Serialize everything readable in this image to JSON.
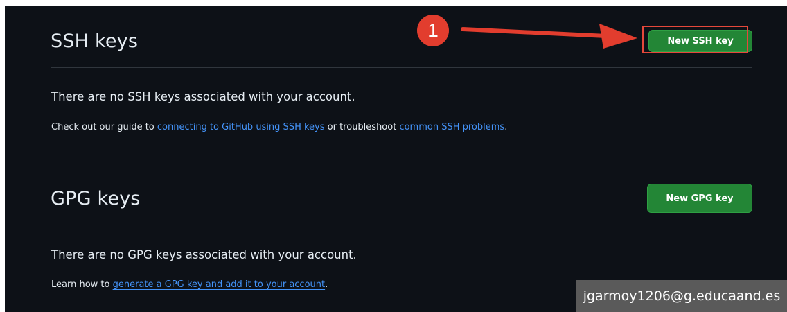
{
  "ssh": {
    "title": "SSH keys",
    "button_label": "New SSH key",
    "empty_message": "There are no SSH keys associated with your account.",
    "help_prefix": "Check out our guide to ",
    "help_link1": "connecting to GitHub using SSH keys",
    "help_middle": " or troubleshoot ",
    "help_link2": "common SSH problems",
    "help_suffix": "."
  },
  "gpg": {
    "title": "GPG keys",
    "button_label": "New GPG key",
    "empty_message": "There are no GPG keys associated with your account.",
    "help_prefix": "Learn how to ",
    "help_link": "generate a GPG key and add it to your account",
    "help_suffix": "."
  },
  "annotation": {
    "step_number": "1",
    "email": "jgarmoy1206@g.educaand.es"
  },
  "colors": {
    "background": "#0d1117",
    "button": "#238636",
    "link": "#4493f8",
    "annotation": "#e23d2e"
  }
}
